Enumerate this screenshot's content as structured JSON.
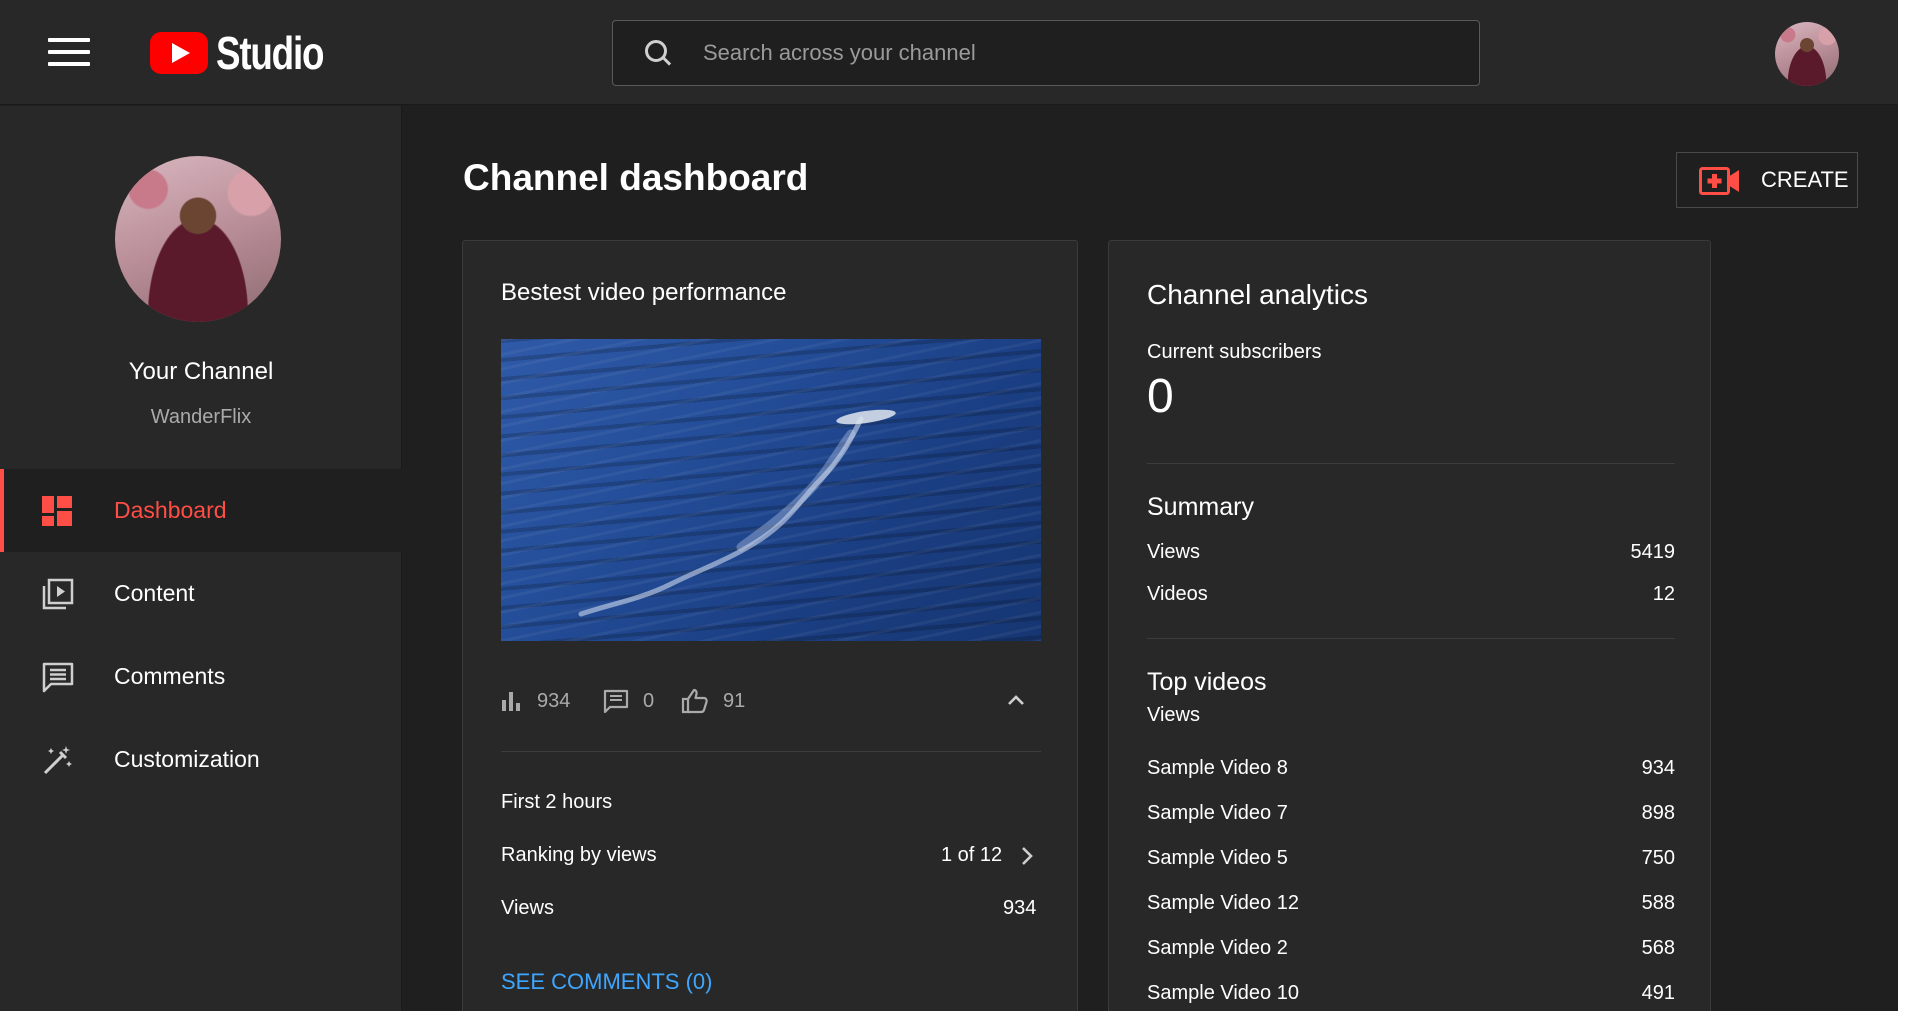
{
  "header": {
    "logo_text": "Studio",
    "search_placeholder": "Search across your channel"
  },
  "sidebar": {
    "channel_title": "Your Channel",
    "channel_handle": "WanderFlix",
    "items": [
      {
        "label": "Dashboard",
        "icon": "dashboard-icon",
        "active": true
      },
      {
        "label": "Content",
        "icon": "content-icon"
      },
      {
        "label": "Comments",
        "icon": "comments-icon"
      },
      {
        "label": "Customization",
        "icon": "customization-icon"
      }
    ]
  },
  "main": {
    "title": "Channel dashboard",
    "create_label": "CREATE"
  },
  "performance": {
    "title": "Bestest video performance",
    "views": "934",
    "comments": "0",
    "likes": "91",
    "period": "First 2 hours",
    "ranking_label": "Ranking by views",
    "ranking_value": "1 of 12",
    "views_label": "Views",
    "views_value": "934",
    "see_comments": "SEE COMMENTS (0)"
  },
  "analytics": {
    "title": "Channel analytics",
    "subscribers_label": "Current subscribers",
    "subscribers_value": "0",
    "summary_title": "Summary",
    "summary": [
      {
        "label": "Views",
        "value": "5419"
      },
      {
        "label": "Videos",
        "value": "12"
      }
    ],
    "top_videos_title": "Top videos",
    "top_videos_subtitle": "Views",
    "top_videos": [
      {
        "label": "Sample Video 8",
        "value": "934"
      },
      {
        "label": "Sample Video 7",
        "value": "898"
      },
      {
        "label": "Sample Video 5",
        "value": "750"
      },
      {
        "label": "Sample Video 12",
        "value": "588"
      },
      {
        "label": "Sample Video 2",
        "value": "568"
      },
      {
        "label": "Sample Video 10",
        "value": "491"
      }
    ]
  },
  "colors": {
    "accent_red": "#ff4e45",
    "link_blue": "#3ea6ff",
    "background": "#1f1f1f",
    "surface": "#282828"
  }
}
